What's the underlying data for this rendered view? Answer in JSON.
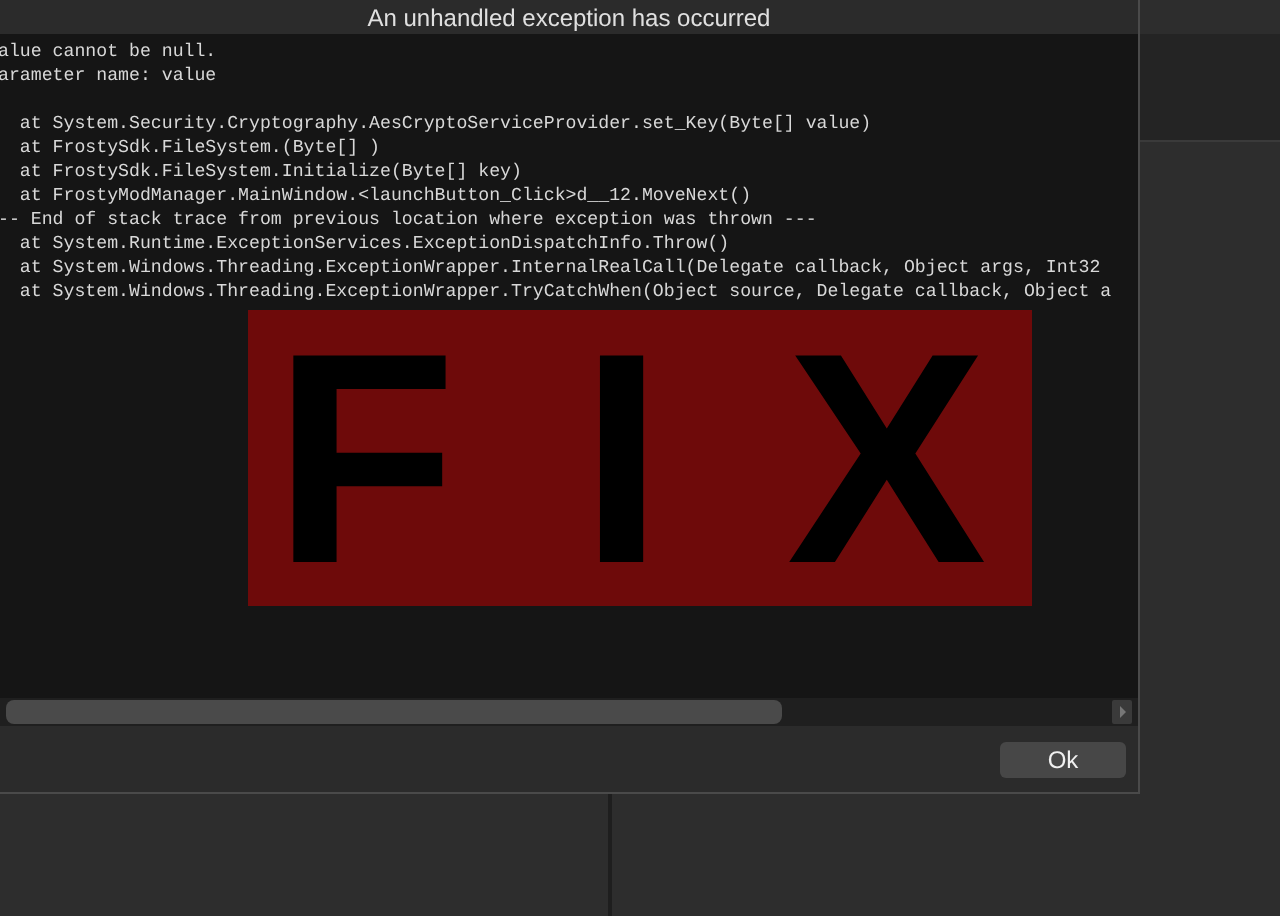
{
  "dialog": {
    "title": "An unhandled exception has occurred",
    "message_lines": [
      "alue cannot be null.",
      "arameter name: value"
    ],
    "stack_trace_lines": [
      "  at System.Security.Cryptography.AesCryptoServiceProvider.set_Key(Byte[] value)",
      "  at FrostySdk.FileSystem.(Byte[] )",
      "  at FrostySdk.FileSystem.Initialize(Byte[] key)",
      "  at FrostyModManager.MainWindow.<launchButton_Click>d__12.MoveNext()",
      "-- End of stack trace from previous location where exception was thrown ---",
      "  at System.Runtime.ExceptionServices.ExceptionDispatchInfo.Throw()",
      "  at System.Windows.Threading.ExceptionWrapper.InternalRealCall(Delegate callback, Object args, Int32",
      "  at System.Windows.Threading.ExceptionWrapper.TryCatchWhen(Object source, Delegate callback, Object a"
    ],
    "buttons": [
      "Ok"
    ]
  },
  "overlay": {
    "text": "F I X"
  }
}
